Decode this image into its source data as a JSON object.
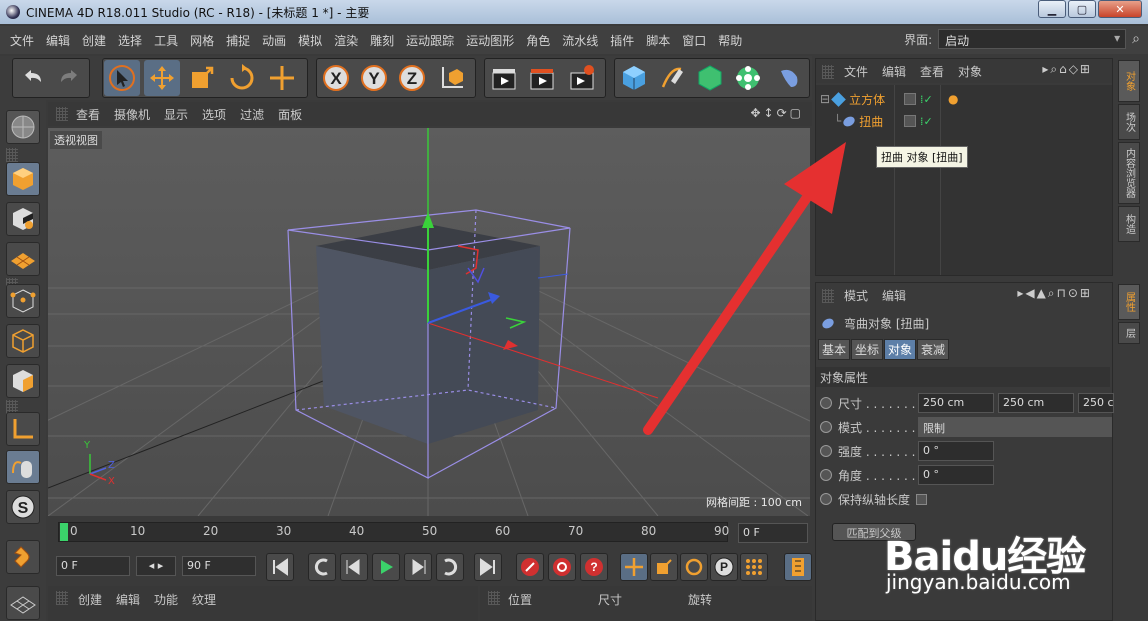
{
  "window": {
    "title": "CINEMA 4D R18.011 Studio (RC - R18) - [未标题 1 *] - 主要"
  },
  "menu": {
    "items": [
      "文件",
      "编辑",
      "创建",
      "选择",
      "工具",
      "网格",
      "捕捉",
      "动画",
      "模拟",
      "渲染",
      "雕刻",
      "运动跟踪",
      "运动图形",
      "角色",
      "流水线",
      "插件",
      "脚本",
      "窗口",
      "帮助"
    ],
    "layout_label": "界面:",
    "layout_value": "启动"
  },
  "viewport": {
    "menu": [
      "查看",
      "摄像机",
      "显示",
      "选项",
      "过滤",
      "面板"
    ],
    "label": "透视视图",
    "grid_spacing": "网格间距 : 100 cm",
    "axis_y": "Y",
    "axis_z": "Z",
    "axis_x": "X"
  },
  "timeline": {
    "ticks": [
      "0",
      "10",
      "20",
      "30",
      "40",
      "50",
      "60",
      "70",
      "80",
      "90"
    ],
    "current_frame": "0 F"
  },
  "transport": {
    "start_frame": "0 F",
    "end_frame": "90 F"
  },
  "material_bar": {
    "items": [
      "创建",
      "编辑",
      "功能",
      "纹理"
    ]
  },
  "coord_bar": {
    "items": [
      "位置",
      "尺寸",
      "旋转"
    ]
  },
  "object_manager": {
    "menu": [
      "文件",
      "编辑",
      "查看",
      "对象"
    ],
    "objects": [
      {
        "name": "立方体",
        "color": "#f0a030"
      },
      {
        "name": "扭曲",
        "color": "#f0a030"
      }
    ],
    "tooltip": "扭曲 对象 [扭曲]"
  },
  "attribute_manager": {
    "menu": [
      "模式",
      "编辑"
    ],
    "object_title": "弯曲对象 [扭曲]",
    "tabs": [
      "基本",
      "坐标",
      "对象",
      "衰减"
    ],
    "active_tab": "对象",
    "section": "对象属性",
    "props": [
      {
        "label": "尺寸 . . . . . . . .",
        "values": [
          "250 cm",
          "250 cm",
          "250 c"
        ]
      },
      {
        "label": "模式 . . . . . . . .",
        "values": [
          "限制"
        ]
      },
      {
        "label": "强度 . . . . . . . .",
        "values": [
          "0 °"
        ]
      },
      {
        "label": "角度 . . . . . . . .",
        "values": [
          "0 °"
        ]
      },
      {
        "label": "保持纵轴长度",
        "values": []
      }
    ],
    "fit_button": "匹配到父级"
  },
  "side_tabs": [
    "对象",
    "场次",
    "内容浏览器",
    "构造",
    "属性",
    "层"
  ],
  "watermark": {
    "brand": "Baidu经验",
    "url": "jingyan.baidu.com"
  },
  "colors": {
    "accent_orange": "#f0a030",
    "arrow_red": "#e53030",
    "active_tab": "#5d7fa8"
  }
}
